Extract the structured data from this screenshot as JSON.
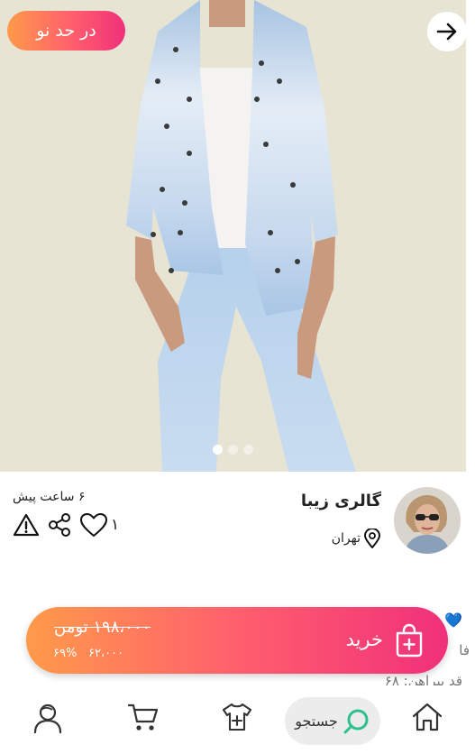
{
  "product": {
    "condition_badge": "در حد نو",
    "image_count": 3,
    "image_active_index": 0
  },
  "post": {
    "time_ago": "۶ ساعت پیش",
    "likes": "۱"
  },
  "seller": {
    "name": "گالری زیبا",
    "location": "تهران"
  },
  "details_peek": {
    "line1": "فا",
    "line2": "قد بیراهن: ۶۸"
  },
  "purchase": {
    "old_price": "۱۹۸،۰۰۰ تومن",
    "new_price": "۶۲،۰۰۰",
    "discount": "۶۹%",
    "buy_label": "خرید"
  },
  "nav": {
    "search_label": "جستجو",
    "items": [
      "home-icon",
      "search-icon",
      "add-product-icon",
      "cart-icon",
      "profile-icon"
    ]
  },
  "colors": {
    "accent_start": "#ff9a4a",
    "accent_end": "#f0307a",
    "search_icon": "#2ebf91"
  }
}
